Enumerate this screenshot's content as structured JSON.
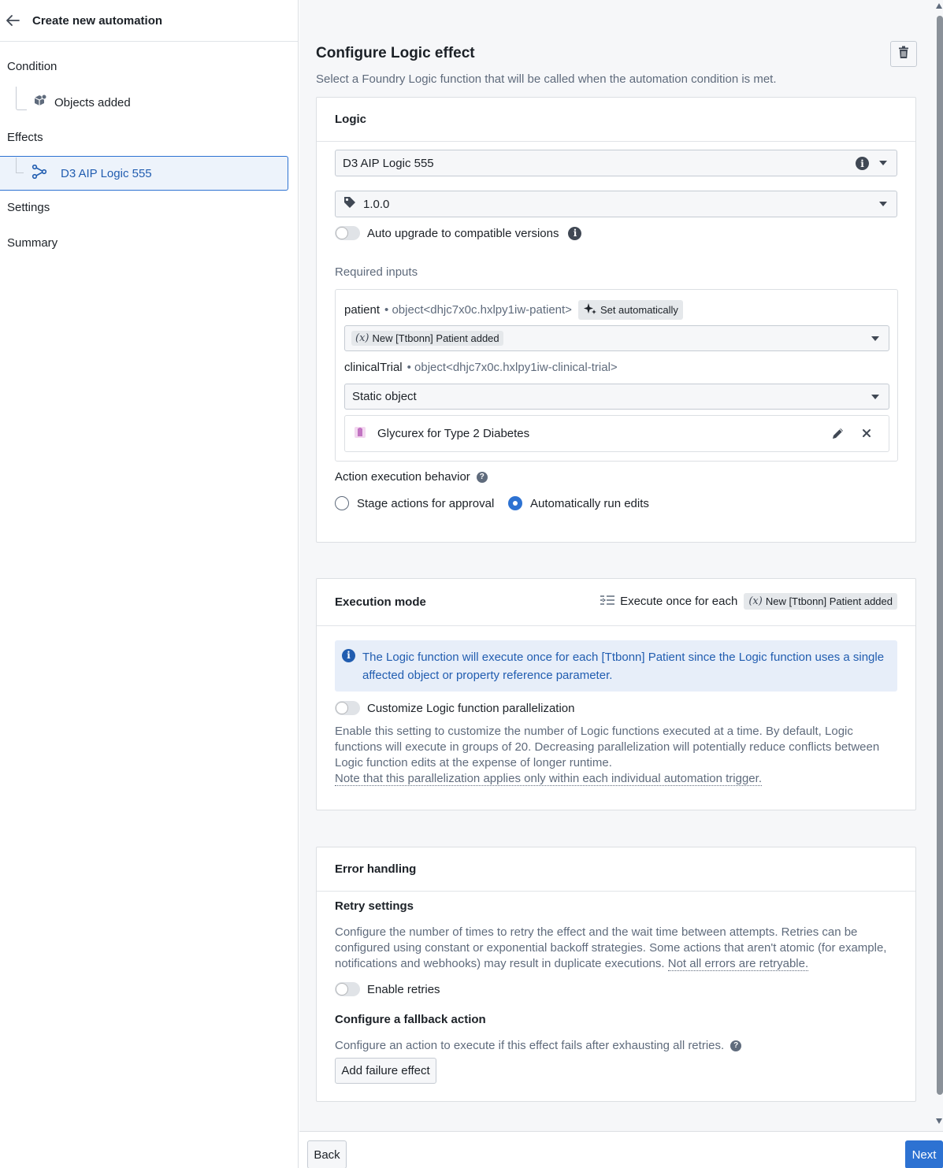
{
  "sidebar": {
    "title": "Create new automation",
    "condition_label": "Condition",
    "condition_item": "Objects added",
    "effects_label": "Effects",
    "effect_item": "D3 AIP Logic 555",
    "settings_label": "Settings",
    "summary_label": "Summary"
  },
  "header": {
    "title": "Configure Logic effect",
    "subtitle": "Select a Foundry Logic function that will be called when the automation condition is met."
  },
  "logic": {
    "section_title": "Logic",
    "function_value": "D3 AIP Logic 555",
    "version_value": "1.0.0",
    "auto_upgrade_label": "Auto upgrade to compatible versions",
    "required_inputs_label": "Required inputs",
    "inputs": [
      {
        "name": "patient",
        "type": "• object<dhjc7x0c.hxlpy1iw-patient>",
        "badge": "Set automatically",
        "value": "New [Ttbonn] Patient added"
      },
      {
        "name": "clinicalTrial",
        "type": "• object<dhjc7x0c.hxlpy1iw-clinical-trial>",
        "value": "Static object",
        "object": "Glycurex for Type 2 Diabetes"
      }
    ],
    "action_behavior_label": "Action execution behavior",
    "option_stage": "Stage actions for approval",
    "option_auto": "Automatically run edits",
    "selected_option": "Automatically run edits"
  },
  "execution": {
    "section_title": "Execution mode",
    "execute_label": "Execute once for each",
    "execute_tag": "New [Ttbonn] Patient added",
    "callout": "The Logic function will execute once for each [Ttbonn] Patient since the Logic function uses a single affected object or property reference parameter.",
    "customize_label": "Customize Logic function parallelization",
    "description": "Enable this setting to customize the number of Logic functions executed at a time. By default, Logic functions will execute in groups of 20. Decreasing parallelization will potentially reduce conflicts between Logic function edits at the expense of longer runtime.",
    "note": "Note that this parallelization applies only within each individual automation trigger."
  },
  "errors": {
    "section_title": "Error handling",
    "retry_title": "Retry settings",
    "retry_desc": "Configure the number of times to retry the effect and the wait time between attempts. Retries can be configured using constant or exponential backoff strategies. Some actions that aren't atomic (for example, notifications and webhooks) may result in duplicate executions.",
    "retry_link": "Not all errors are retryable.",
    "enable_retries_label": "Enable retries",
    "fallback_title": "Configure a fallback action",
    "fallback_desc": "Configure an action to execute if this effect fails after exhausting all retries.",
    "add_failure_label": "Add failure effect"
  },
  "footer": {
    "back_label": "Back",
    "next_label": "Next"
  },
  "colors": {
    "accent": "#2d72d2",
    "accent_text": "#215db0",
    "callout_bg": "#e7eef9",
    "muted_text": "#5f6b7c"
  },
  "icons": [
    "arrow-left-icon",
    "cube-add-icon",
    "logic-graph-icon",
    "trash-icon",
    "info-icon",
    "tag-icon",
    "sparkle-icon",
    "variable-icon",
    "object-icon",
    "edit-icon",
    "close-icon",
    "help-icon",
    "list-icon"
  ]
}
